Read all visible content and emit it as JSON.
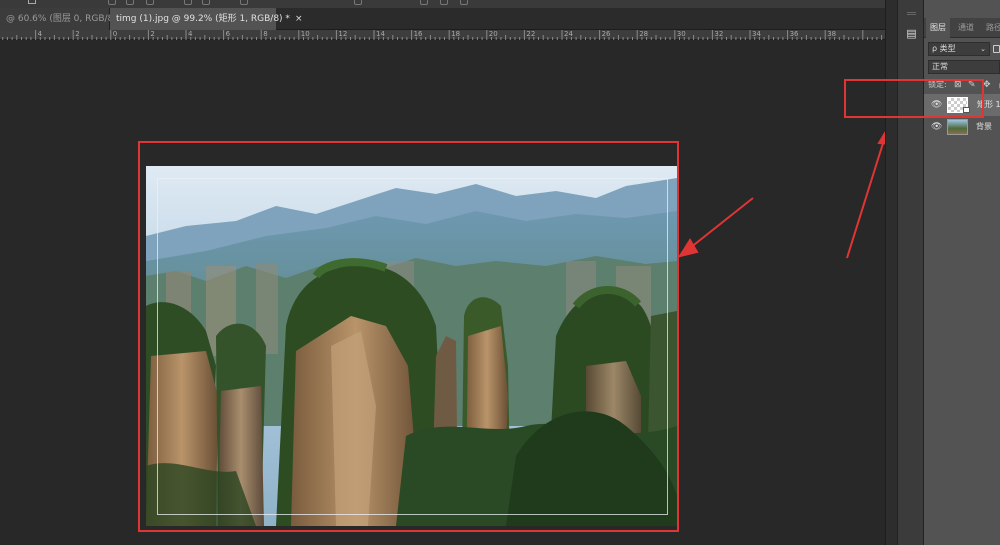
{
  "tabs": [
    {
      "label": "@ 60.6% (图层 0, RGB/8) *",
      "close": "×",
      "active": false
    },
    {
      "label": "timg (1).jpg @ 99.2% (矩形 1, RGB/8) *",
      "close": "×",
      "active": true
    }
  ],
  "ruler": {
    "numbers": [
      "6",
      "4",
      "2",
      "0",
      "2",
      "4",
      "6",
      "8",
      "10",
      "12",
      "14",
      "16",
      "18",
      "20",
      "22",
      "24",
      "26",
      "28",
      "30",
      "32",
      "34",
      "36",
      "38"
    ]
  },
  "panel": {
    "tabs": [
      "图层",
      "通道",
      "路径"
    ],
    "filter_label": "ρ 类型",
    "blend_mode": "正常",
    "lock_label": "锁定:",
    "layers": [
      {
        "name": "矩形 1",
        "selected": true,
        "thumb": "shape"
      },
      {
        "name": "背景",
        "selected": false,
        "thumb": "image"
      }
    ]
  },
  "annotation_color": "#e03535",
  "icons": {
    "visibility": "eye-icon",
    "close": "close-icon",
    "properties": "properties-icon",
    "lock": "lock-icon"
  }
}
